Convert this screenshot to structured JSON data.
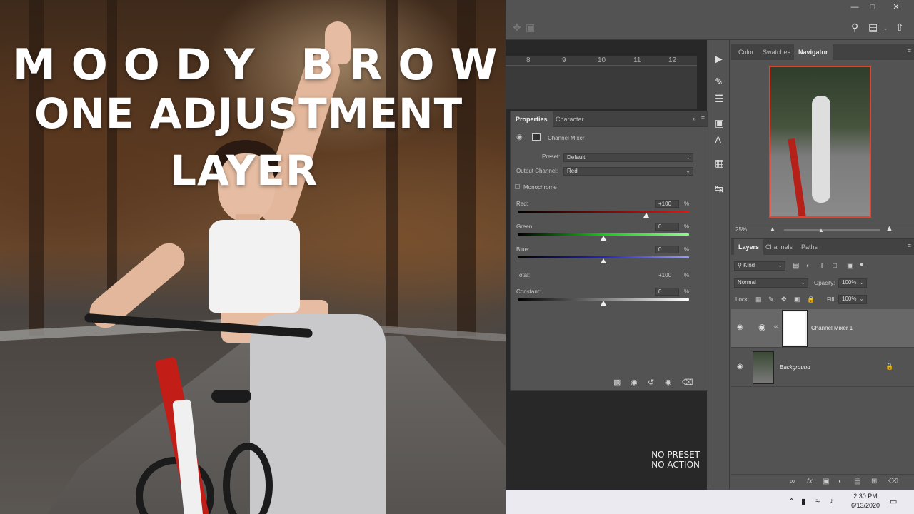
{
  "thumbnail": {
    "title_line1": "MOODY BROWN",
    "title_line2": "ONE ADJUSTMENT",
    "title_line3": "LAYER",
    "watermark_line1": "NO PRESET",
    "watermark_line2": "NO ACTION"
  },
  "ruler": {
    "ticks": [
      "8",
      "9",
      "10",
      "11",
      "12"
    ]
  },
  "properties_panel": {
    "tabs": [
      "Properties",
      "Character"
    ],
    "active_tab": "Properties",
    "adjustment_name": "Channel Mixer",
    "preset_label": "Preset:",
    "preset_value": "Default",
    "output_channel_label": "Output Channel:",
    "output_channel_value": "Red",
    "monochrome_label": "Monochrome",
    "monochrome_checked": false,
    "channels": [
      {
        "label": "Red:",
        "value": "+100",
        "unit": "%",
        "slider_position": 0.75
      },
      {
        "label": "Green:",
        "value": "0",
        "unit": "%",
        "slider_position": 0.5
      },
      {
        "label": "Blue:",
        "value": "0",
        "unit": "%",
        "slider_position": 0.5
      }
    ],
    "total_label": "Total:",
    "total_value": "+100",
    "total_unit": "%",
    "constant_label": "Constant:",
    "constant_value": "0",
    "constant_unit": "%",
    "constant_slider_position": 0.5
  },
  "navigator_panel": {
    "tabs": [
      "Color",
      "Swatches",
      "Navigator"
    ],
    "active_tab": "Navigator",
    "zoom": "25%"
  },
  "layers_panel": {
    "tabs": [
      "Layers",
      "Channels",
      "Paths"
    ],
    "active_tab": "Layers",
    "filter_label": "Kind",
    "blend_mode": "Normal",
    "opacity_label": "Opacity:",
    "opacity_value": "100%",
    "lock_label": "Lock:",
    "fill_label": "Fill:",
    "fill_value": "100%",
    "layers": [
      {
        "name": "Channel Mixer 1",
        "active": true
      },
      {
        "name": "Background",
        "active": false,
        "locked": true
      }
    ]
  },
  "taskbar": {
    "time": "2:30 PM",
    "date": "6/13/2020"
  },
  "colors": {
    "accent_red": "#e0462f",
    "panel_bg": "#535353",
    "panel_dark": "#424242"
  }
}
